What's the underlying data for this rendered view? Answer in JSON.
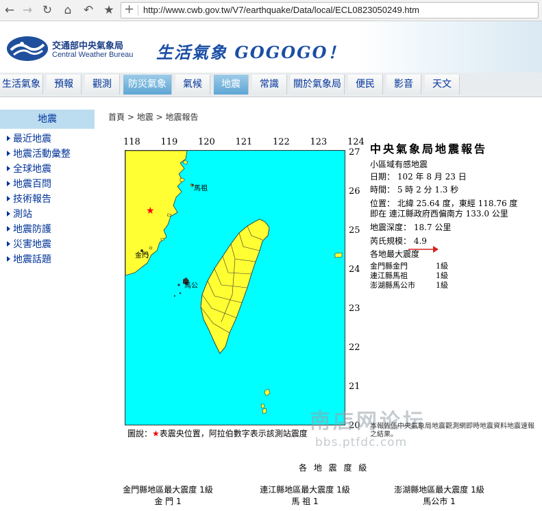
{
  "browser": {
    "url": "http://www.cwb.gov.tw/V7/earthquake/Data/local/ECL0823050249.htm"
  },
  "header": {
    "org_zh": "交通部中央氣象局",
    "org_en": "Central Weather Bureau",
    "slogan": "生活氣象 GOGOGO！"
  },
  "nav": {
    "items": [
      {
        "label": "生活氣象",
        "active": false
      },
      {
        "label": "預報",
        "active": false
      },
      {
        "label": "觀測",
        "active": false
      },
      {
        "label": "防災氣象",
        "active": true
      },
      {
        "label": "氣候",
        "active": false
      },
      {
        "label": "地震",
        "active": true
      },
      {
        "label": "常識",
        "active": false
      },
      {
        "label": "關於氣象局",
        "active": false
      },
      {
        "label": "便民",
        "active": false
      },
      {
        "label": "影音",
        "active": false
      },
      {
        "label": "天文",
        "active": false
      }
    ]
  },
  "sidebar": {
    "title": "地震",
    "items": [
      "最近地震",
      "地震活動彙整",
      "全球地震",
      "地震百問",
      "技術報告",
      "測站",
      "地震防護",
      "災害地震",
      "地震話題"
    ]
  },
  "breadcrumb": {
    "home": "首頁",
    "sep1": ">",
    "level1": "地震",
    "sep2": ">",
    "level2": "地震報告"
  },
  "map": {
    "lon_ticks": [
      "118",
      "119",
      "120",
      "121",
      "122",
      "123",
      "124"
    ],
    "lat_ticks": [
      "27",
      "26",
      "25",
      "24",
      "23",
      "22",
      "21",
      "20"
    ],
    "station_labels": {
      "matsu": "馬祖",
      "kinmen": "金門",
      "penghu": "馬公"
    },
    "sea_color": "#00ffff",
    "land_color": "#ffff33",
    "epicenter_color": "#ff0000"
  },
  "caption": {
    "prefix": "圖說：",
    "star": "★",
    "text": "表震央位置，阿拉伯數字表示該測站震度"
  },
  "report": {
    "title": "中央氣象局地震報告",
    "type": "小區域有感地震",
    "date": "日期： 102 年 8 月 23 日",
    "time": "時間： 5 時 2 分 1.3 秒",
    "position": "位置： 北緯 25.64 度，東經 118.76 度",
    "relative": "即在  連江縣政府西偏南方 133.0 公里",
    "depth": "地震深度： 18.7 公里",
    "magnitude": "芮氏規模： 4.9",
    "max_header": "各地最大震度",
    "locations": [
      {
        "name": "金門縣金門",
        "level": "1級"
      },
      {
        "name": "連江縣馬祖",
        "level": "1級"
      },
      {
        "name": "澎湖縣馬公市",
        "level": "1級"
      }
    ],
    "note": "本報告係中央氣象局地震觀測網即時地震資料地震速報之結果。"
  },
  "watermark": {
    "line1": "南店网论坛",
    "line2": "bbs.ptfdc.com"
  },
  "intensity_section": {
    "title": "各 地 震 度 級",
    "counties": [
      {
        "header": "金門縣地區最大震度  1級",
        "station": "金  門  1"
      },
      {
        "header": "連江縣地區最大震度  1級",
        "station": "馬  祖  1"
      },
      {
        "header": "澎湖縣地區最大震度  1級",
        "station": "馬公市  1"
      }
    ]
  }
}
